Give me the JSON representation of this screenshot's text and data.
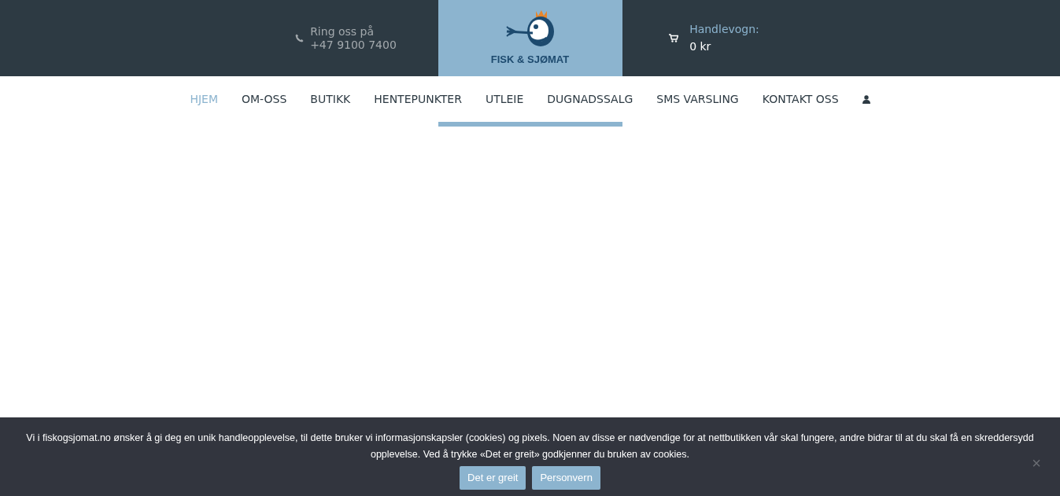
{
  "header": {
    "phone_label": "Ring oss på",
    "phone_number": "+47 9100 7400",
    "logo_text": "FISK & SJØMAT",
    "cart_label": "Handlevogn:",
    "cart_total": "0 kr"
  },
  "nav": [
    {
      "label": "HJEM",
      "selected": true
    },
    {
      "label": "OM-OSS",
      "selected": false
    },
    {
      "label": "BUTIKK",
      "selected": false
    },
    {
      "label": "HENTEPUNKTER",
      "selected": false
    },
    {
      "label": "UTLEIE",
      "selected": false
    },
    {
      "label": "DUGNADSSALG",
      "selected": false
    },
    {
      "label": "SMS VARSLING",
      "selected": false
    },
    {
      "label": "KONTAKT OSS",
      "selected": false
    },
    {
      "kind": "account",
      "selected": false
    }
  ],
  "cookie_notice": {
    "text": "Vi i fiskogsjomat.no ønsker å gi deg en unik handleopplevelse, til dette bruker vi informasjonskapsler (cookies) og pixels. Noen av disse er nødvendige for at nettbutikken vår skal fungere, andre bidrar til at du skal få en skreddersydd opplevelse. Ved å trykke «Det er greit» godkjenner du bruken av cookies.",
    "buttons": [
      "Det er greit",
      "Personvern"
    ],
    "close": "×"
  }
}
